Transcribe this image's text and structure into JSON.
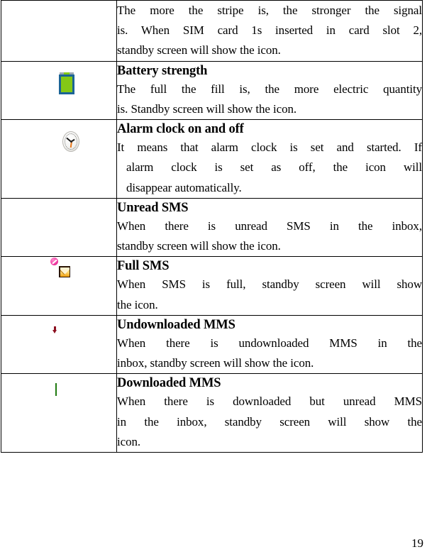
{
  "document": {
    "page_number": "19",
    "rows": [
      {
        "icon": "signal-strength-icon",
        "icon_visible": false,
        "title": "",
        "lines": [
          "The more the stripe is, the stronger the signal",
          "is. When SIM card 1s inserted in card slot 2,",
          "standby screen will show the icon."
        ]
      },
      {
        "icon": "battery-icon",
        "icon_visible": true,
        "title": "Battery strength",
        "lines": [
          "The full the fill is, the more electric quantity",
          "is. Standby screen will show the icon."
        ]
      },
      {
        "icon": "alarm-clock-icon",
        "icon_visible": true,
        "title": "Alarm clock on and off",
        "lines": [
          "It means that alarm clock is set and started. If",
          "alarm clock is set as off, the icon will",
          "disappear automatically."
        ]
      },
      {
        "icon": "unread-sms-icon",
        "icon_visible": true,
        "title": "Unread SMS",
        "lines": [
          "When there is unread SMS in the inbox,",
          "standby screen will show the icon."
        ]
      },
      {
        "icon": "full-sms-icon",
        "icon_visible": true,
        "title": "Full SMS",
        "lines": [
          "When SMS is full, standby screen will show",
          "the icon."
        ]
      },
      {
        "icon": "undownloaded-mms-icon",
        "icon_visible": true,
        "title": "Undownloaded MMS",
        "lines": [
          "When there is undownloaded MMS in the",
          "inbox, standby screen will show the icon."
        ]
      },
      {
        "icon": "downloaded-mms-icon",
        "icon_visible": true,
        "title": "Downloaded MMS",
        "lines": [
          "When there is downloaded but unread MMS",
          "in the inbox, standby screen will show the",
          "icon."
        ]
      }
    ]
  },
  "colors": {
    "battery_fill": "#84c816",
    "battery_border": "#1b6496",
    "clock_background": "#2a6fae",
    "sms_envelope": "#f2a30d",
    "full_sms_badge": "#f23aa3",
    "mms_panel": "#1f6fa8",
    "mms_envelope": "#ffd7ea",
    "downloaded_mms_green": "#2f9e16",
    "text": "#000000",
    "border": "#000000"
  }
}
